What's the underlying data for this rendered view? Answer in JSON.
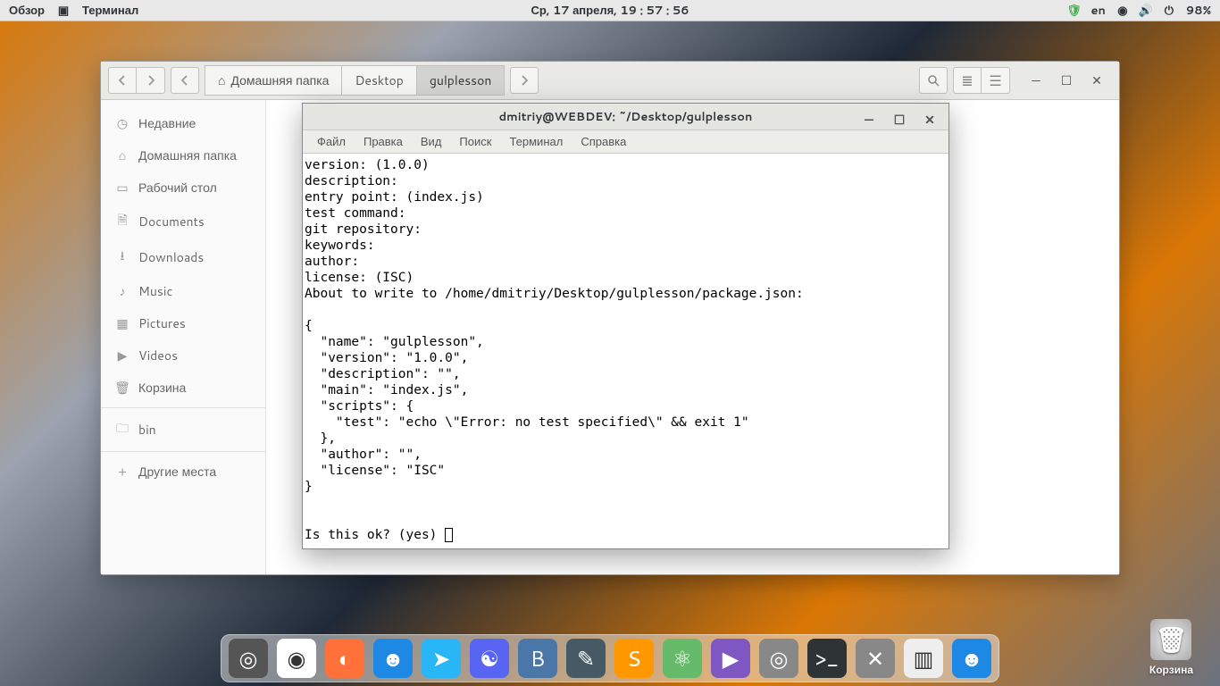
{
  "panel": {
    "overview": "Обзор",
    "app_name": "Терминал",
    "clock": "Ср, 17 апреля, 19 : 57 : 56",
    "lang": "en",
    "battery": "98%"
  },
  "fm": {
    "breadcrumb": {
      "home": "Домашняя папка",
      "desktop": "Desktop",
      "current": "gulplesson"
    },
    "sidebar": [
      "Недавние",
      "Домашняя папка",
      "Рабочий стол",
      "Documents",
      "Downloads",
      "Music",
      "Pictures",
      "Videos",
      "Корзина",
      "bin",
      "Другие места"
    ]
  },
  "terminal": {
    "title": "dmitriy@WEBDEV: ~/Desktop/gulplesson",
    "menu": [
      "Файл",
      "Правка",
      "Вид",
      "Поиск",
      "Терминал",
      "Справка"
    ],
    "lines": [
      "version: (1.0.0)",
      "description:",
      "entry point: (index.js)",
      "test command:",
      "git repository:",
      "keywords:",
      "author:",
      "license: (ISC)",
      "About to write to /home/dmitriy/Desktop/gulplesson/package.json:",
      "",
      "{",
      "  \"name\": \"gulplesson\",",
      "  \"version\": \"1.0.0\",",
      "  \"description\": \"\",",
      "  \"main\": \"index.js\",",
      "  \"scripts\": {",
      "    \"test\": \"echo \\\"Error: no test specified\\\" && exit 1\"",
      "  },",
      "  \"author\": \"\",",
      "  \"license\": \"ISC\"",
      "}",
      "",
      ""
    ],
    "prompt": "Is this ok? (yes) "
  },
  "trash_label": "Корзина",
  "dock": [
    {
      "name": "launcher",
      "color": "#555",
      "glyph": "◎"
    },
    {
      "name": "chrome",
      "color": "#fff",
      "glyph": "◉"
    },
    {
      "name": "firefox",
      "color": "#ff7139",
      "glyph": "◐"
    },
    {
      "name": "finder",
      "color": "#1e88e5",
      "glyph": "☻"
    },
    {
      "name": "telegram",
      "color": "#29b6f6",
      "glyph": "➤"
    },
    {
      "name": "discord",
      "color": "#5865f2",
      "glyph": "☯"
    },
    {
      "name": "vk",
      "color": "#4a76a8",
      "glyph": "B"
    },
    {
      "name": "editor",
      "color": "#455a64",
      "glyph": "✎"
    },
    {
      "name": "sublime",
      "color": "#ff9800",
      "glyph": "S"
    },
    {
      "name": "atom",
      "color": "#66bb6a",
      "glyph": "⚛"
    },
    {
      "name": "phpstorm",
      "color": "#7e57c2",
      "glyph": "▶"
    },
    {
      "name": "owl",
      "color": "#888",
      "glyph": "◎"
    },
    {
      "name": "terminal",
      "color": "#2e3436",
      "glyph": ">_"
    },
    {
      "name": "settings",
      "color": "#888",
      "glyph": "✕"
    },
    {
      "name": "palette",
      "color": "#eee",
      "glyph": "▥"
    },
    {
      "name": "finder2",
      "color": "#1e88e5",
      "glyph": "☻"
    }
  ]
}
